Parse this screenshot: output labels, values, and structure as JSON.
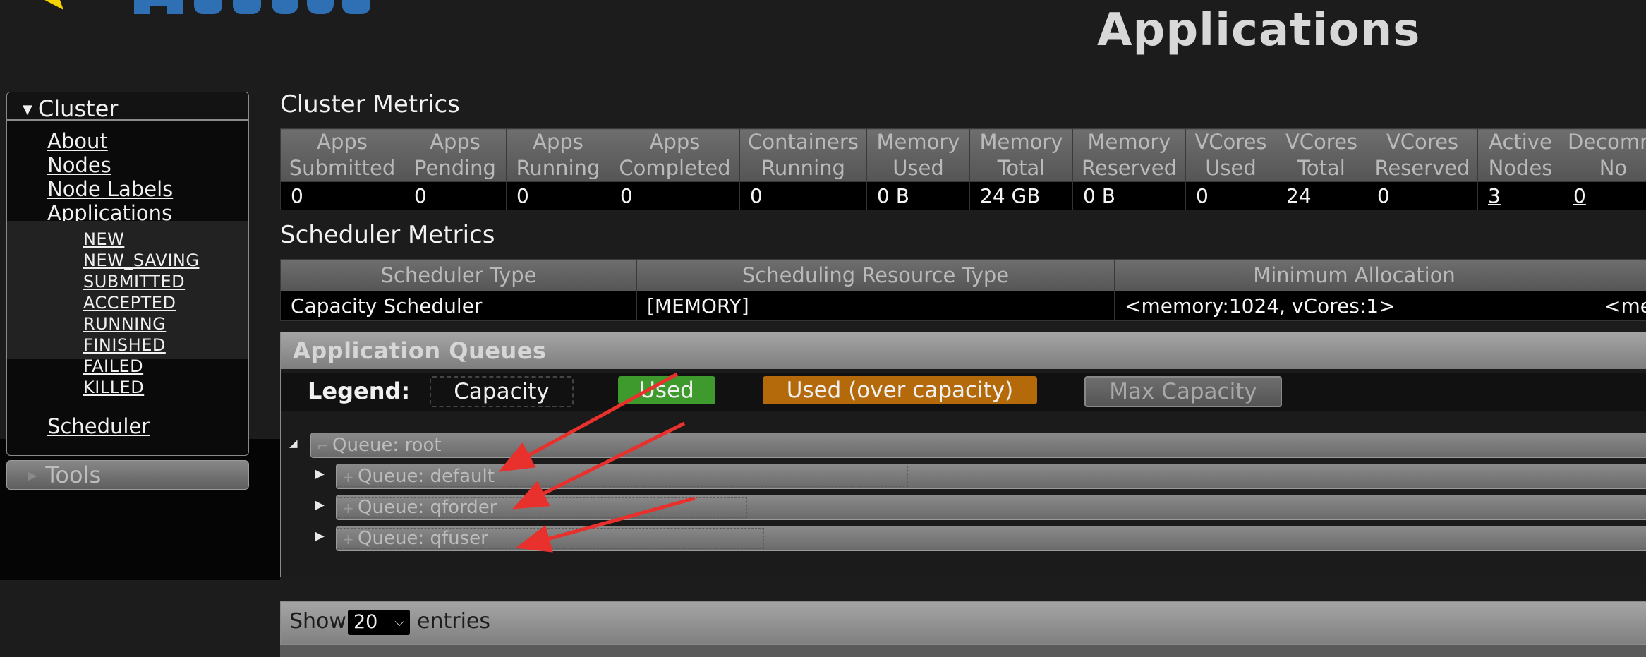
{
  "page": {
    "title": "Applications"
  },
  "sidebar": {
    "cluster_label": "Cluster",
    "links": [
      "About",
      "Nodes",
      "Node Labels",
      "Applications"
    ],
    "app_states": [
      "NEW",
      "NEW_SAVING",
      "SUBMITTED",
      "ACCEPTED",
      "RUNNING",
      "FINISHED",
      "FAILED",
      "KILLED"
    ],
    "scheduler_label": "Scheduler",
    "tools_label": "Tools"
  },
  "cluster_metrics": {
    "title": "Cluster Metrics",
    "headers": [
      [
        "Apps",
        "Submitted"
      ],
      [
        "Apps",
        "Pending"
      ],
      [
        "Apps",
        "Running"
      ],
      [
        "Apps",
        "Completed"
      ],
      [
        "Containers",
        "Running"
      ],
      [
        "Memory",
        "Used"
      ],
      [
        "Memory",
        "Total"
      ],
      [
        "Memory",
        "Reserved"
      ],
      [
        "VCores",
        "Used"
      ],
      [
        "VCores",
        "Total"
      ],
      [
        "VCores",
        "Reserved"
      ],
      [
        "Active",
        "Nodes"
      ],
      [
        "Decomm",
        "No"
      ]
    ],
    "values": [
      "0",
      "0",
      "0",
      "0",
      "0",
      "0 B",
      "24 GB",
      "0 B",
      "0",
      "24",
      "0",
      "3",
      "0"
    ]
  },
  "scheduler_metrics": {
    "title": "Scheduler Metrics",
    "headers": [
      "Scheduler Type",
      "Scheduling Resource Type",
      "Minimum Allocation",
      ""
    ],
    "values": [
      "Capacity Scheduler",
      "[MEMORY]",
      "<memory:1024, vCores:1>",
      "<me"
    ]
  },
  "queues": {
    "title": "Application Queues",
    "legend_label": "Legend:",
    "legend": {
      "capacity": "Capacity",
      "used": "Used",
      "over": "Used (over capacity)",
      "max": "Max Capacity"
    },
    "root": "Queue: root",
    "children": [
      "Queue: default",
      "Queue: qforder",
      "Queue: qfuser"
    ]
  },
  "entries": {
    "show": "Show",
    "count": "20",
    "suffix": "entries"
  },
  "colors": {
    "used": "#3f9a2e",
    "over_capacity": "#b46a0a",
    "annotation_arrow": "#e8302c"
  }
}
